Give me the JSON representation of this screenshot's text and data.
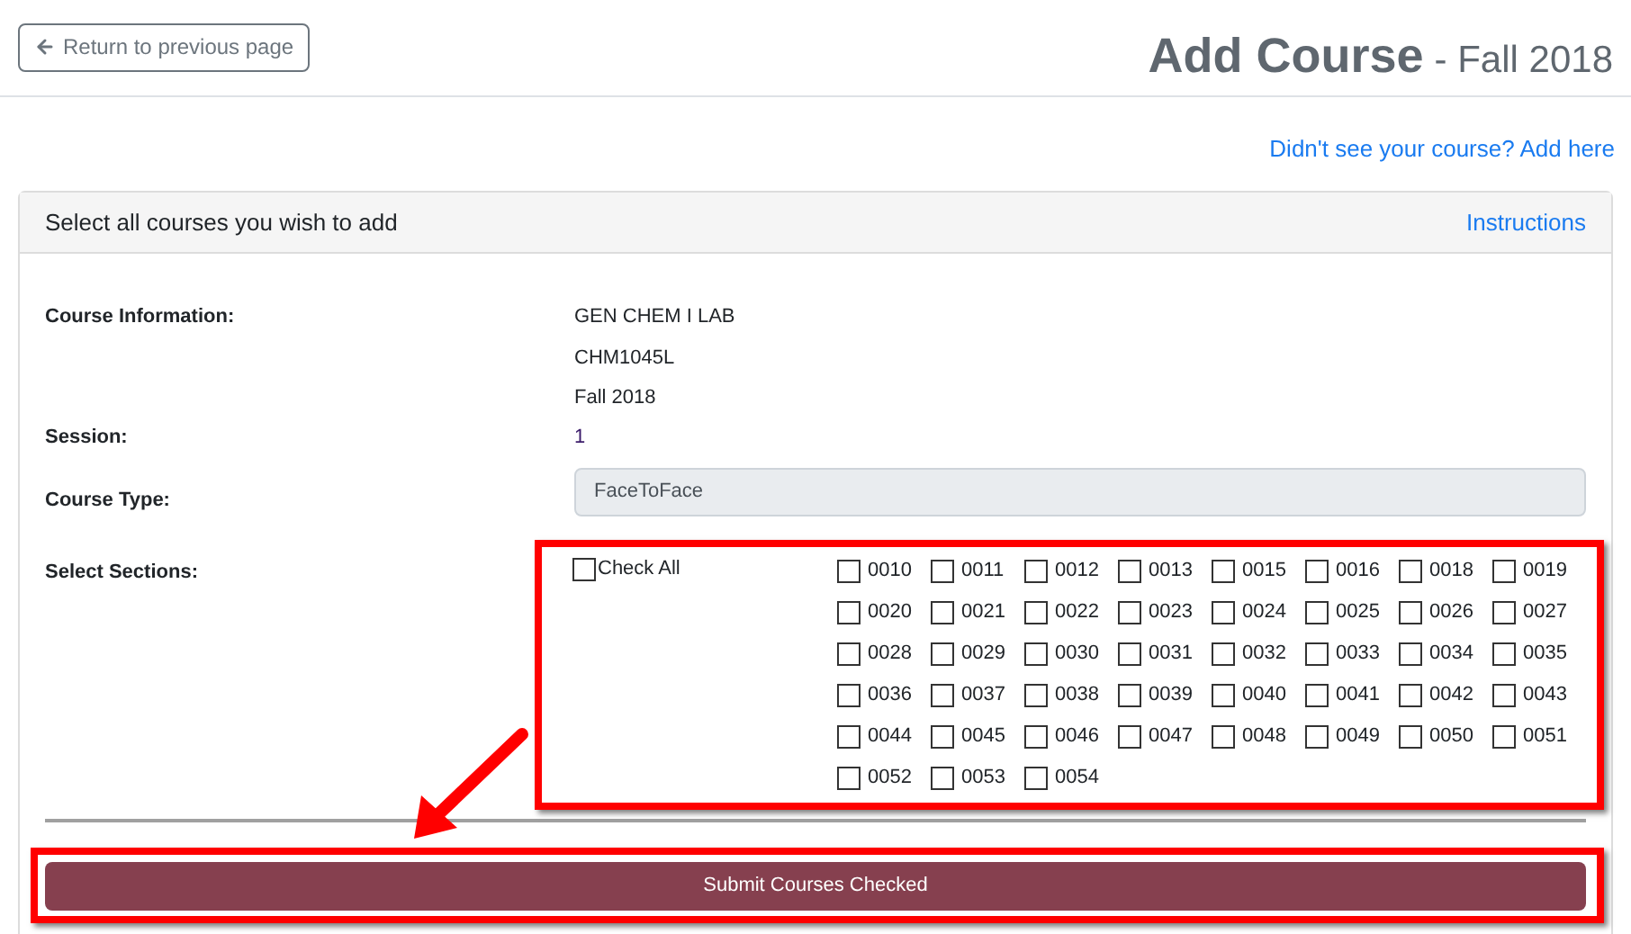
{
  "back_button": {
    "label": "Return to previous page"
  },
  "heading": {
    "title": "Add Course",
    "subtitle": "- Fall 2018"
  },
  "add_link": "Didn't see your course? Add here",
  "card": {
    "header": "Select all courses you wish to add",
    "instructions_link": "Instructions"
  },
  "course_information": {
    "label": "Course Information:",
    "lines": [
      "GEN CHEM I LAB",
      "CHM1045L",
      "Fall 2018"
    ]
  },
  "session": {
    "label": "Session:",
    "value": "1"
  },
  "course_type": {
    "label": "Course Type:",
    "value": "FaceToFace"
  },
  "sections": {
    "label": "Select Sections:",
    "check_all": {
      "label": "Check All",
      "checked": false
    },
    "items": [
      {
        "label": "0010",
        "checked": false
      },
      {
        "label": "0011",
        "checked": false
      },
      {
        "label": "0012",
        "checked": false
      },
      {
        "label": "0013",
        "checked": false
      },
      {
        "label": "0015",
        "checked": false
      },
      {
        "label": "0016",
        "checked": false
      },
      {
        "label": "0018",
        "checked": false
      },
      {
        "label": "0019",
        "checked": false
      },
      {
        "label": "0020",
        "checked": false
      },
      {
        "label": "0021",
        "checked": false
      },
      {
        "label": "0022",
        "checked": false
      },
      {
        "label": "0023",
        "checked": false
      },
      {
        "label": "0024",
        "checked": false
      },
      {
        "label": "0025",
        "checked": false
      },
      {
        "label": "0026",
        "checked": false
      },
      {
        "label": "0027",
        "checked": false
      },
      {
        "label": "0028",
        "checked": false
      },
      {
        "label": "0029",
        "checked": false
      },
      {
        "label": "0030",
        "checked": false
      },
      {
        "label": "0031",
        "checked": false
      },
      {
        "label": "0032",
        "checked": false
      },
      {
        "label": "0033",
        "checked": false
      },
      {
        "label": "0034",
        "checked": false
      },
      {
        "label": "0035",
        "checked": false
      },
      {
        "label": "0036",
        "checked": false
      },
      {
        "label": "0037",
        "checked": false
      },
      {
        "label": "0038",
        "checked": false
      },
      {
        "label": "0039",
        "checked": false
      },
      {
        "label": "0040",
        "checked": false
      },
      {
        "label": "0041",
        "checked": false
      },
      {
        "label": "0042",
        "checked": false
      },
      {
        "label": "0043",
        "checked": false
      },
      {
        "label": "0044",
        "checked": false
      },
      {
        "label": "0045",
        "checked": false
      },
      {
        "label": "0046",
        "checked": false
      },
      {
        "label": "0047",
        "checked": false
      },
      {
        "label": "0048",
        "checked": false
      },
      {
        "label": "0049",
        "checked": false
      },
      {
        "label": "0050",
        "checked": false
      },
      {
        "label": "0051",
        "checked": false
      },
      {
        "label": "0052",
        "checked": false
      },
      {
        "label": "0053",
        "checked": false
      },
      {
        "label": "0054",
        "checked": false
      }
    ]
  },
  "submit_button": "Submit Courses Checked"
}
